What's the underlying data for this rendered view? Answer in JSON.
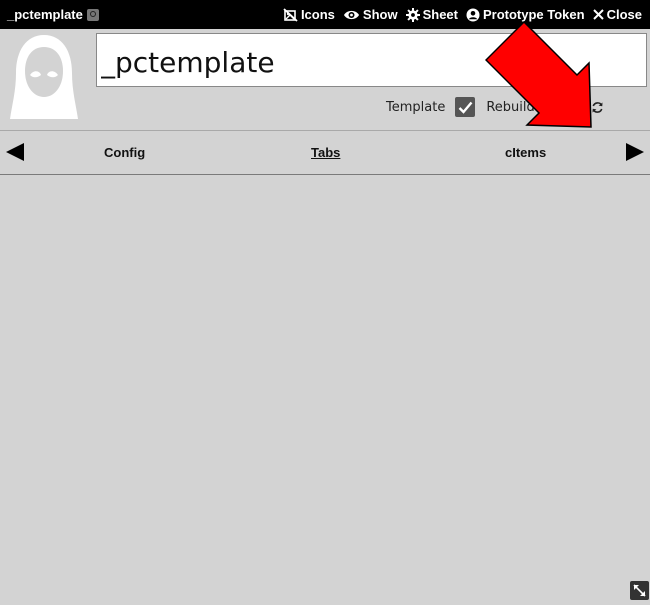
{
  "window": {
    "title": "_pctemplate",
    "controls": [
      {
        "label": "Icons",
        "icon": "no-image-icon"
      },
      {
        "label": "Show",
        "icon": "eye-icon"
      },
      {
        "label": "Sheet",
        "icon": "gear-icon"
      },
      {
        "label": "Prototype Token",
        "icon": "user-circle-icon"
      },
      {
        "label": "Close",
        "icon": "close-icon"
      }
    ]
  },
  "sheet": {
    "name_value": "_pctemplate",
    "template_label": "Template",
    "template_checked": true,
    "rebuild_label": "Rebuild Sheet",
    "refresh_icon": "refresh-icon"
  },
  "tabs": {
    "items": [
      {
        "label": "Config",
        "active": false
      },
      {
        "label": "Tabs",
        "active": true
      },
      {
        "label": "cItems",
        "active": false
      }
    ]
  },
  "colors": {
    "header_bg": "#000000",
    "body_bg": "#d3d3d3",
    "annotation_arrow": "#ff0000"
  }
}
